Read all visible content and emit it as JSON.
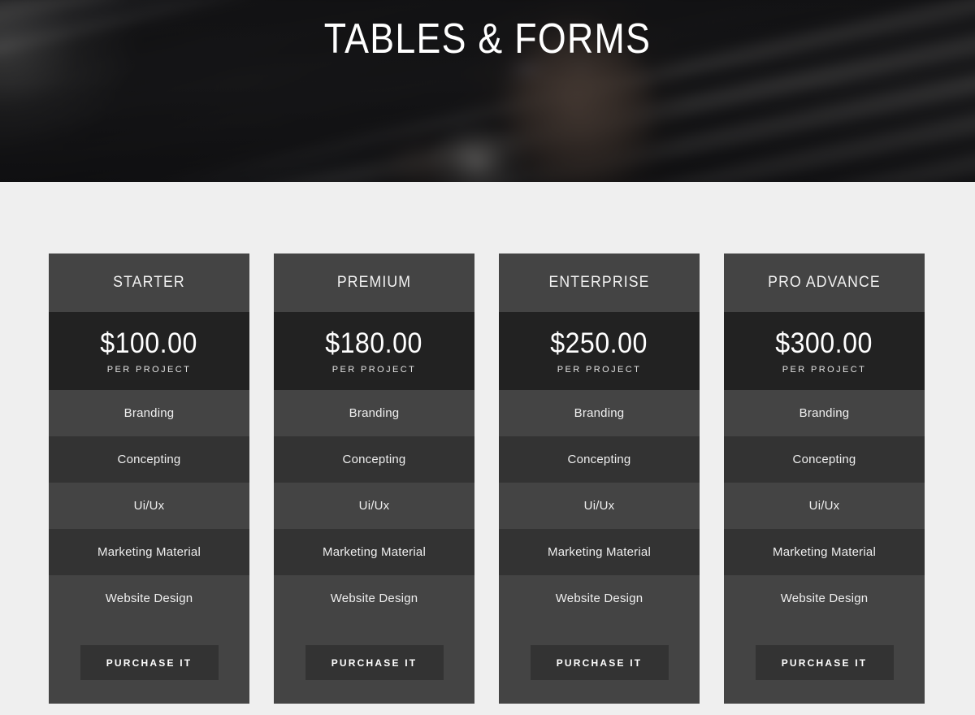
{
  "hero": {
    "title": "TABLES & FORMS",
    "background_image": "dark-office-person-with-glasses-reading-paper"
  },
  "colors": {
    "page_background": "#efefef",
    "card_header_background": "#444444",
    "card_price_background": "#222222",
    "feature_row_light": "#444444",
    "feature_row_dark": "#333333",
    "button_background": "#333333",
    "text_primary": "#ffffff"
  },
  "pricing": {
    "period_label": "PER PROJECT",
    "button_label": "PURCHASE IT",
    "cards": [
      {
        "name": "STARTER",
        "price": "$100.00",
        "period": "PER PROJECT",
        "features": [
          "Branding",
          "Concepting",
          "Ui/Ux",
          "Marketing Material",
          "Website Design"
        ],
        "button_label": "PURCHASE IT"
      },
      {
        "name": "PREMIUM",
        "price": "$180.00",
        "period": "PER PROJECT",
        "features": [
          "Branding",
          "Concepting",
          "Ui/Ux",
          "Marketing Material",
          "Website Design"
        ],
        "button_label": "PURCHASE IT"
      },
      {
        "name": "ENTERPRISE",
        "price": "$250.00",
        "period": "PER PROJECT",
        "features": [
          "Branding",
          "Concepting",
          "Ui/Ux",
          "Marketing Material",
          "Website Design"
        ],
        "button_label": "PURCHASE IT"
      },
      {
        "name": "PRO ADVANCE",
        "price": "$300.00",
        "period": "PER PROJECT",
        "features": [
          "Branding",
          "Concepting",
          "Ui/Ux",
          "Marketing Material",
          "Website Design"
        ],
        "button_label": "PURCHASE IT"
      }
    ]
  }
}
